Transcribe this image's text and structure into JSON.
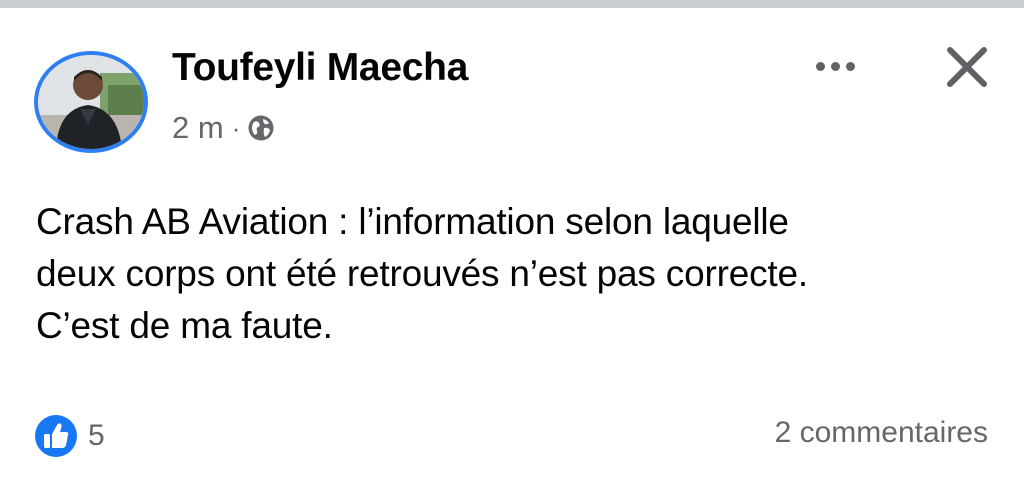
{
  "post": {
    "author": "Toufeyli Maecha",
    "time": "2 m",
    "separator": "·",
    "privacy_icon": "globe-icon",
    "text": "Crash AB Aviation : l’information selon laquelle\ndeux corps ont été retrouvés n’est pas correcte.\nC’est de ma faute."
  },
  "header_actions": {
    "more_icon": "more-horizontal-icon",
    "close_icon": "close-icon"
  },
  "footer": {
    "reaction_icon": "like-icon",
    "reaction_count": "5",
    "comments": "2 commentaires"
  },
  "colors": {
    "accent": "#1877f2",
    "avatar_ring": "#2e80f2",
    "text_primary": "#050505",
    "text_secondary": "#65676b",
    "icon_gray": "#606266"
  }
}
